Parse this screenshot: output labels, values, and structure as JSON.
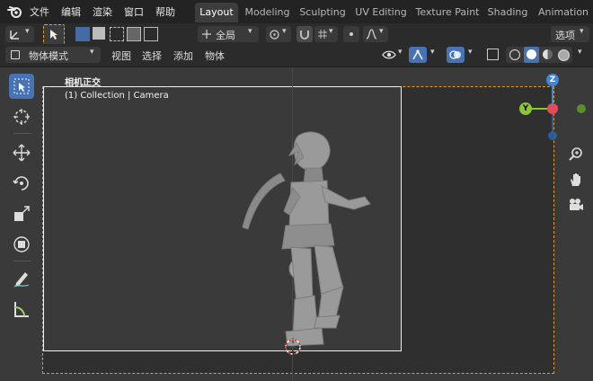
{
  "menu": {
    "items": [
      "文件",
      "编辑",
      "渲染",
      "窗口",
      "帮助"
    ]
  },
  "workspaces": {
    "tabs": [
      "Layout",
      "Modeling",
      "Sculpting",
      "UV Editing",
      "Texture Paint",
      "Shading",
      "Animation"
    ],
    "active": "Layout"
  },
  "tool_settings": {
    "transform_orientation": "全局",
    "options_label": "选项"
  },
  "header": {
    "mode": "物体模式",
    "menus": [
      "视图",
      "选择",
      "添加",
      "物体"
    ]
  },
  "viewport": {
    "view_name": "相机正交",
    "collection_info": "(1) Collection | Camera"
  },
  "gizmo": {
    "z_label": "Z",
    "y_label": "Y"
  },
  "colors": {
    "accent": "#4772b3",
    "camera_frame": "#e0a030",
    "axis_x": "#e24b5c",
    "axis_y": "#8cc43c",
    "axis_z": "#3f86d6"
  }
}
